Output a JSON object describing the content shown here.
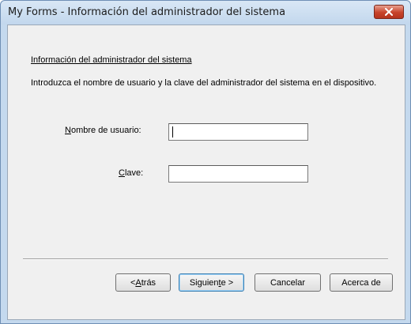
{
  "window": {
    "title": "My Forms - Información del administrador del sistema"
  },
  "dialog": {
    "heading": "Información del administrador del sistema",
    "description": "Introduzca el nombre de usuario y la clave del administrador del sistema en el dispositivo.",
    "username": {
      "label_hotkey": "N",
      "label_rest": "ombre de usuario:",
      "value": ""
    },
    "password": {
      "label_hotkey": "C",
      "label_rest": "lave:",
      "value": ""
    }
  },
  "buttons": {
    "back": {
      "prefix": "< ",
      "hotkey": "A",
      "rest": "trás"
    },
    "next": {
      "prefix": "Siguien",
      "hotkey": "t",
      "rest": "e >"
    },
    "cancel": "Cancelar",
    "about": "Acerca de"
  },
  "icons": {
    "close": "close-icon"
  }
}
